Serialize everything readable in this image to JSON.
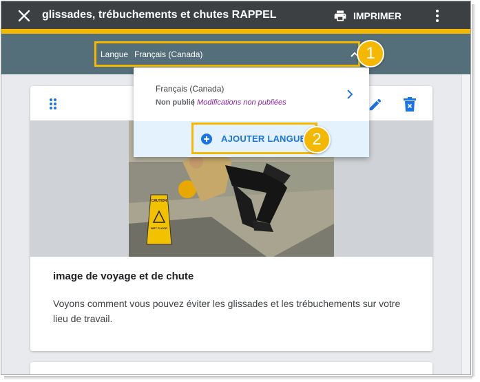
{
  "header": {
    "title": "glissades, trébuchements et chutes RAPPEL",
    "print_label": "IMPRIMER",
    "close_icon": "close-icon",
    "print_icon": "printer-icon",
    "more_icon": "more-vert-icon"
  },
  "language_bar": {
    "label": "Langue",
    "value": "Français (Canada)",
    "chevron_icon": "chevron-up-icon"
  },
  "dropdown": {
    "item_name": "Français (Canada)",
    "item_status": "Non publié",
    "item_separator": "|",
    "item_changes": "Modifications non publiées",
    "add_label": "AJOUTER LANGUES",
    "add_icon": "add-circle-icon"
  },
  "callouts": [
    "1",
    "2"
  ],
  "card": {
    "heading": "image de voyage et de chute",
    "text": "Voyons comment vous pouvez éviter les glissades et les trébuchements sur votre lieu de travail.",
    "sign_line1": "CAUTION",
    "sign_line2": "WET FLOOR",
    "icons": [
      "drag-handle-icon",
      "pencil-icon",
      "trash-icon"
    ]
  },
  "colors": {
    "topbar": "#3c4043",
    "accent_yellow": "#f5b800",
    "language_bar": "#546e7a",
    "link_blue": "#1a73e8",
    "unpublished_purple": "#8e24aa"
  }
}
